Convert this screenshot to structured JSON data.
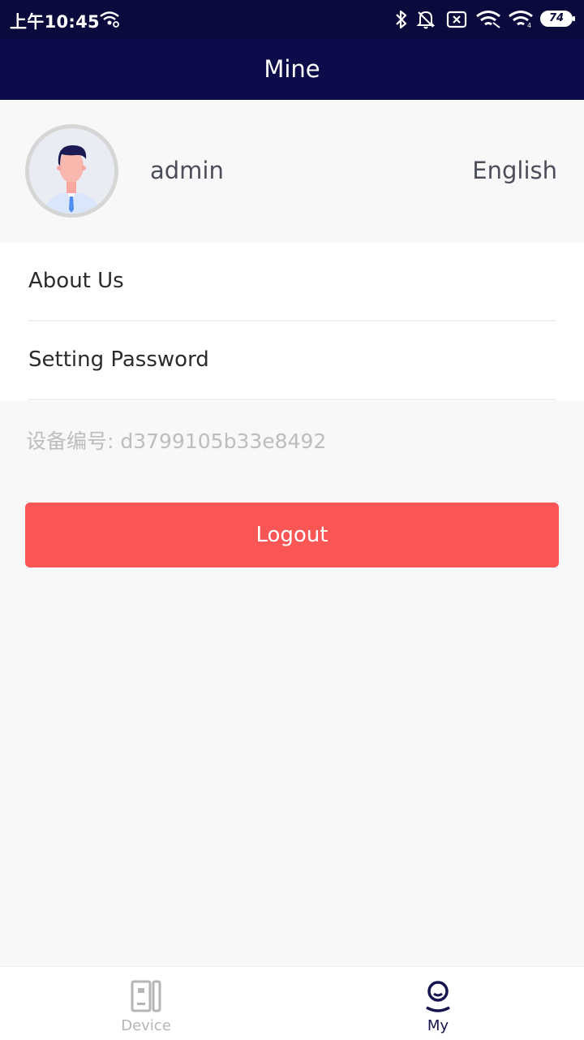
{
  "status_bar": {
    "time": "上午10:45",
    "battery": "74",
    "icons": [
      "wifi-hotspot-icon",
      "bluetooth-icon",
      "bell-off-icon",
      "sim-off-icon",
      "wifi-icon",
      "wifi-icon",
      "battery-icon"
    ]
  },
  "header": {
    "title": "Mine"
  },
  "profile": {
    "avatar_icon": "user-avatar-icon",
    "username": "admin",
    "language": "English"
  },
  "menu": {
    "items": [
      {
        "label": "About Us"
      },
      {
        "label": "Setting Password"
      }
    ]
  },
  "device_id": "设备编号: d3799105b33e8492",
  "logout_label": "Logout",
  "tabbar": {
    "tabs": [
      {
        "label": "Device",
        "icon": "device-icon",
        "active": false
      },
      {
        "label": "My",
        "icon": "user-icon",
        "active": true
      }
    ]
  },
  "colors": {
    "header": "#0d0c4b",
    "status_bar": "#0b0a3c",
    "logout": "#fa5656",
    "active_tab": "#14134f",
    "inactive_tab": "#b5b5b5"
  }
}
